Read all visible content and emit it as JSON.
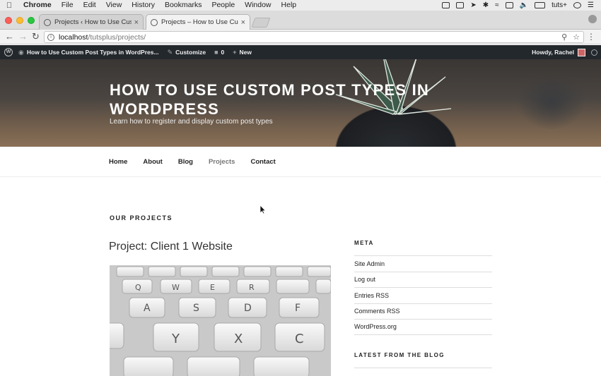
{
  "menubar": {
    "app": "Chrome",
    "items": [
      "File",
      "Edit",
      "View",
      "History",
      "Bookmarks",
      "People",
      "Window",
      "Help"
    ],
    "user": "tuts+"
  },
  "tabs": [
    {
      "title": "Projects ‹ How to Use Custom"
    },
    {
      "title": "Projects – How to Use Custom"
    }
  ],
  "address": {
    "host": "localhost",
    "path": "/tutsplus/projects/"
  },
  "adminbar": {
    "site_name": "How to Use Custom Post Types in WordPres...",
    "customize": "Customize",
    "comments_count": "0",
    "new_label": "New",
    "howdy": "Howdy, Rachel"
  },
  "site": {
    "title": "HOW TO USE CUSTOM POST TYPES IN WORDPRESS",
    "description": "Learn how to register and display custom post types"
  },
  "nav": [
    "Home",
    "About",
    "Blog",
    "Projects",
    "Contact"
  ],
  "nav_current": "Projects",
  "content": {
    "page_heading": "OUR PROJECTS",
    "entry_title": "Project: Client 1 Website"
  },
  "sidebar": {
    "meta_title": "META",
    "meta_items": [
      "Site Admin",
      "Log out",
      "Entries RSS",
      "Comments RSS",
      "WordPress.org"
    ],
    "blog_title": "LATEST FROM THE BLOG"
  },
  "keyboard_keys": [
    "Q",
    "W",
    "E",
    "R",
    "A",
    "S",
    "D",
    "F",
    "Y",
    "X",
    "C"
  ]
}
